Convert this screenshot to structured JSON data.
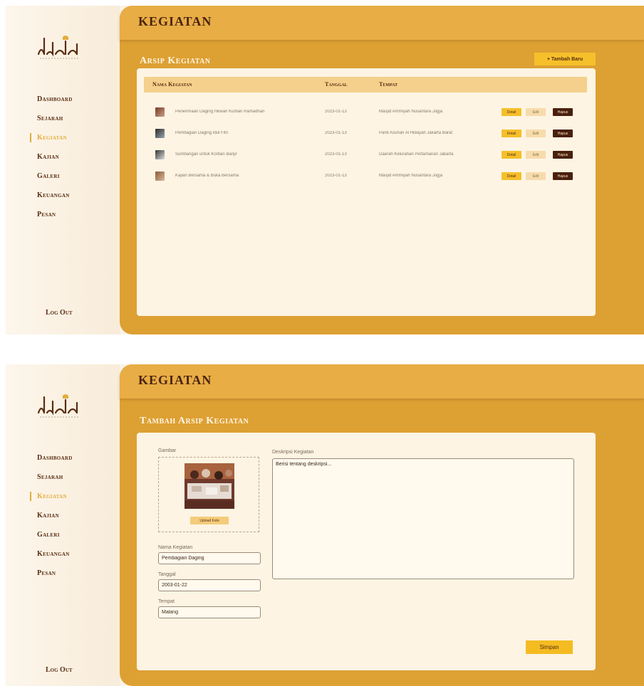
{
  "colors": {
    "sidebar_bg": "#fbf3e6",
    "main_bg": "#dda033",
    "topbar_bg": "#e8ad45",
    "card_bg": "#fdf4e3",
    "accent_yellow": "#f5bc21",
    "dark_brown": "#4a200d",
    "active_nav": "#e2ad3b"
  },
  "sidebar": {
    "logo_icon": "mosque-calligraphy-logo",
    "items": [
      {
        "label": "Dashboard"
      },
      {
        "label": "Sejarah"
      },
      {
        "label": "Kegiatan"
      },
      {
        "label": "Kajian"
      },
      {
        "label": "Galeri"
      },
      {
        "label": "Keuangan"
      },
      {
        "label": "Pesan"
      }
    ],
    "active": "Kegiatan",
    "logout": "Log Out"
  },
  "screen1": {
    "page_title": "KEGIATAN",
    "section_title": "Arsip Kegiatan",
    "add_button": "+ Tambah Baru",
    "table": {
      "headers": {
        "name": "Nama Kegiatan",
        "date": "Tanggal",
        "place": "Tempat"
      },
      "rows": [
        {
          "name": "Penerimaan Daging Hewan Kurban Ramadhan",
          "date": "2023-01-13",
          "place": "Masjid Ammiyah Nusantara Jogja",
          "detail": "Detail",
          "edit": "Edit",
          "delete": "Hapus"
        },
        {
          "name": "Pembagian Daging Idul Fitri",
          "date": "2023-01-13",
          "place": "Panti Asuhan Al Hidayah Jakarta Barat",
          "detail": "Detail",
          "edit": "Edit",
          "delete": "Hapus"
        },
        {
          "name": "Sumbangan untuk Korban Banjir",
          "date": "2023-01-13",
          "place": "Daerah Kelurahan Pertamanan Jakarta",
          "detail": "Detail",
          "edit": "Edit",
          "delete": "Hapus"
        },
        {
          "name": "Kajian Bersama & Buka Bersama",
          "date": "2023-01-13",
          "place": "Masjid Ammiyah Nusantara Jogja",
          "detail": "Detail",
          "edit": "Edit",
          "delete": "Hapus"
        }
      ]
    }
  },
  "screen2": {
    "page_title": "KEGIATAN",
    "section_title": "Tambah Arsip Kegiatan",
    "form": {
      "gambar_label": "Gambar",
      "upload_button": "Upload Foto",
      "nama_label": "Nama Kegiatan",
      "nama_value": "Pembagian Daging",
      "tanggal_label": "Tanggal",
      "tanggal_value": "2003-01-22",
      "tempat_label": "Tempat",
      "tempat_value": "Malang",
      "deskripsi_label": "Deskripsi Kegiatan",
      "deskripsi_placeholder": "Berisi tentang deskripsi...",
      "save_button": "Simpan"
    }
  }
}
